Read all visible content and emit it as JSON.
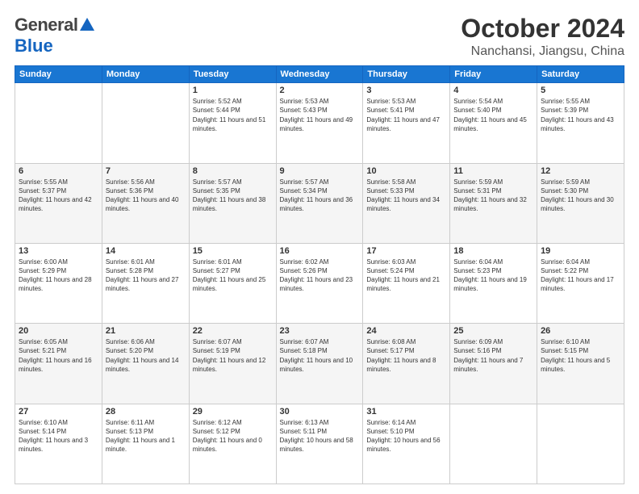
{
  "header": {
    "logo_general": "General",
    "logo_blue": "Blue",
    "month_title": "October 2024",
    "location": "Nanchansi, Jiangsu, China"
  },
  "days_of_week": [
    "Sunday",
    "Monday",
    "Tuesday",
    "Wednesday",
    "Thursday",
    "Friday",
    "Saturday"
  ],
  "weeks": [
    [
      {
        "day": "",
        "sunrise": "",
        "sunset": "",
        "daylight": ""
      },
      {
        "day": "",
        "sunrise": "",
        "sunset": "",
        "daylight": ""
      },
      {
        "day": "1",
        "sunrise": "Sunrise: 5:52 AM",
        "sunset": "Sunset: 5:44 PM",
        "daylight": "Daylight: 11 hours and 51 minutes."
      },
      {
        "day": "2",
        "sunrise": "Sunrise: 5:53 AM",
        "sunset": "Sunset: 5:43 PM",
        "daylight": "Daylight: 11 hours and 49 minutes."
      },
      {
        "day": "3",
        "sunrise": "Sunrise: 5:53 AM",
        "sunset": "Sunset: 5:41 PM",
        "daylight": "Daylight: 11 hours and 47 minutes."
      },
      {
        "day": "4",
        "sunrise": "Sunrise: 5:54 AM",
        "sunset": "Sunset: 5:40 PM",
        "daylight": "Daylight: 11 hours and 45 minutes."
      },
      {
        "day": "5",
        "sunrise": "Sunrise: 5:55 AM",
        "sunset": "Sunset: 5:39 PM",
        "daylight": "Daylight: 11 hours and 43 minutes."
      }
    ],
    [
      {
        "day": "6",
        "sunrise": "Sunrise: 5:55 AM",
        "sunset": "Sunset: 5:37 PM",
        "daylight": "Daylight: 11 hours and 42 minutes."
      },
      {
        "day": "7",
        "sunrise": "Sunrise: 5:56 AM",
        "sunset": "Sunset: 5:36 PM",
        "daylight": "Daylight: 11 hours and 40 minutes."
      },
      {
        "day": "8",
        "sunrise": "Sunrise: 5:57 AM",
        "sunset": "Sunset: 5:35 PM",
        "daylight": "Daylight: 11 hours and 38 minutes."
      },
      {
        "day": "9",
        "sunrise": "Sunrise: 5:57 AM",
        "sunset": "Sunset: 5:34 PM",
        "daylight": "Daylight: 11 hours and 36 minutes."
      },
      {
        "day": "10",
        "sunrise": "Sunrise: 5:58 AM",
        "sunset": "Sunset: 5:33 PM",
        "daylight": "Daylight: 11 hours and 34 minutes."
      },
      {
        "day": "11",
        "sunrise": "Sunrise: 5:59 AM",
        "sunset": "Sunset: 5:31 PM",
        "daylight": "Daylight: 11 hours and 32 minutes."
      },
      {
        "day": "12",
        "sunrise": "Sunrise: 5:59 AM",
        "sunset": "Sunset: 5:30 PM",
        "daylight": "Daylight: 11 hours and 30 minutes."
      }
    ],
    [
      {
        "day": "13",
        "sunrise": "Sunrise: 6:00 AM",
        "sunset": "Sunset: 5:29 PM",
        "daylight": "Daylight: 11 hours and 28 minutes."
      },
      {
        "day": "14",
        "sunrise": "Sunrise: 6:01 AM",
        "sunset": "Sunset: 5:28 PM",
        "daylight": "Daylight: 11 hours and 27 minutes."
      },
      {
        "day": "15",
        "sunrise": "Sunrise: 6:01 AM",
        "sunset": "Sunset: 5:27 PM",
        "daylight": "Daylight: 11 hours and 25 minutes."
      },
      {
        "day": "16",
        "sunrise": "Sunrise: 6:02 AM",
        "sunset": "Sunset: 5:26 PM",
        "daylight": "Daylight: 11 hours and 23 minutes."
      },
      {
        "day": "17",
        "sunrise": "Sunrise: 6:03 AM",
        "sunset": "Sunset: 5:24 PM",
        "daylight": "Daylight: 11 hours and 21 minutes."
      },
      {
        "day": "18",
        "sunrise": "Sunrise: 6:04 AM",
        "sunset": "Sunset: 5:23 PM",
        "daylight": "Daylight: 11 hours and 19 minutes."
      },
      {
        "day": "19",
        "sunrise": "Sunrise: 6:04 AM",
        "sunset": "Sunset: 5:22 PM",
        "daylight": "Daylight: 11 hours and 17 minutes."
      }
    ],
    [
      {
        "day": "20",
        "sunrise": "Sunrise: 6:05 AM",
        "sunset": "Sunset: 5:21 PM",
        "daylight": "Daylight: 11 hours and 16 minutes."
      },
      {
        "day": "21",
        "sunrise": "Sunrise: 6:06 AM",
        "sunset": "Sunset: 5:20 PM",
        "daylight": "Daylight: 11 hours and 14 minutes."
      },
      {
        "day": "22",
        "sunrise": "Sunrise: 6:07 AM",
        "sunset": "Sunset: 5:19 PM",
        "daylight": "Daylight: 11 hours and 12 minutes."
      },
      {
        "day": "23",
        "sunrise": "Sunrise: 6:07 AM",
        "sunset": "Sunset: 5:18 PM",
        "daylight": "Daylight: 11 hours and 10 minutes."
      },
      {
        "day": "24",
        "sunrise": "Sunrise: 6:08 AM",
        "sunset": "Sunset: 5:17 PM",
        "daylight": "Daylight: 11 hours and 8 minutes."
      },
      {
        "day": "25",
        "sunrise": "Sunrise: 6:09 AM",
        "sunset": "Sunset: 5:16 PM",
        "daylight": "Daylight: 11 hours and 7 minutes."
      },
      {
        "day": "26",
        "sunrise": "Sunrise: 6:10 AM",
        "sunset": "Sunset: 5:15 PM",
        "daylight": "Daylight: 11 hours and 5 minutes."
      }
    ],
    [
      {
        "day": "27",
        "sunrise": "Sunrise: 6:10 AM",
        "sunset": "Sunset: 5:14 PM",
        "daylight": "Daylight: 11 hours and 3 minutes."
      },
      {
        "day": "28",
        "sunrise": "Sunrise: 6:11 AM",
        "sunset": "Sunset: 5:13 PM",
        "daylight": "Daylight: 11 hours and 1 minute."
      },
      {
        "day": "29",
        "sunrise": "Sunrise: 6:12 AM",
        "sunset": "Sunset: 5:12 PM",
        "daylight": "Daylight: 11 hours and 0 minutes."
      },
      {
        "day": "30",
        "sunrise": "Sunrise: 6:13 AM",
        "sunset": "Sunset: 5:11 PM",
        "daylight": "Daylight: 10 hours and 58 minutes."
      },
      {
        "day": "31",
        "sunrise": "Sunrise: 6:14 AM",
        "sunset": "Sunset: 5:10 PM",
        "daylight": "Daylight: 10 hours and 56 minutes."
      },
      {
        "day": "",
        "sunrise": "",
        "sunset": "",
        "daylight": ""
      },
      {
        "day": "",
        "sunrise": "",
        "sunset": "",
        "daylight": ""
      }
    ]
  ]
}
